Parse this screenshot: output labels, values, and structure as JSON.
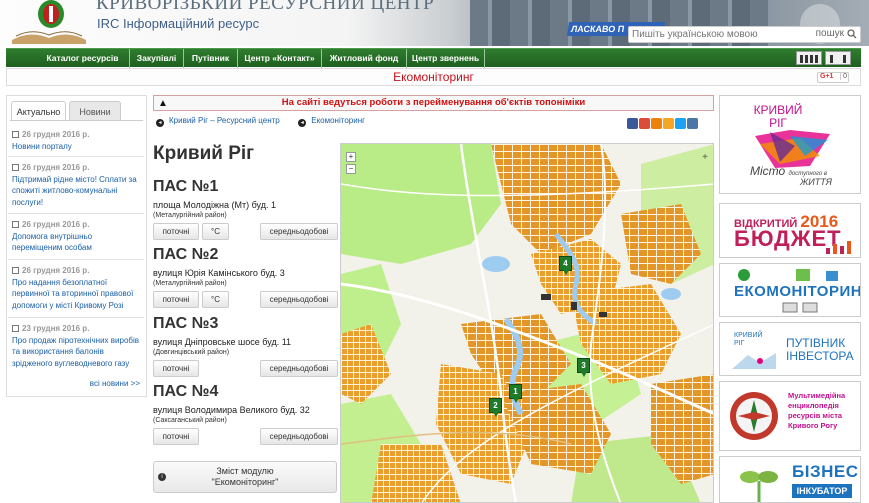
{
  "header": {
    "title_main": "КРИВОРІЗЬКИЙ РЕСУРСНИЙ ЦЕНТР",
    "title_sub": "IRC Інформаційний ресурс",
    "building_sign": "ЛАСКАВО П",
    "search_placeholder": "Пишіть українською мовою",
    "search_button": "пошук"
  },
  "nav": {
    "items": [
      "Каталог ресурсів",
      "Закупівлі",
      "Путівник",
      "Центр «Контакт»",
      "Житловий фонд",
      "Центр звернень"
    ]
  },
  "subtitle": "Екомоніторинг",
  "gplus": {
    "label": "G+1",
    "count": "0"
  },
  "left": {
    "tabs": [
      "Актуально",
      "Новини"
    ],
    "news": [
      {
        "date": "26 грудня 2016 р.",
        "title": "Новини порталу"
      },
      {
        "date": "26 грудня 2016 р.",
        "title": "Підтримай рідне місто! Сплати за спожиті житлово-комунальні послуги!"
      },
      {
        "date": "26 грудня 2016 р.",
        "title": "Допомога внутрішньо переміщеним особам"
      },
      {
        "date": "26 грудня 2016 р.",
        "title": "Про надання безоплатної первинної та вторинної правової допомоги у місті Кривому Розі"
      },
      {
        "date": "23 грудня 2016 р.",
        "title": "Про продаж піротехнічних виробів та використання балонів зрідженого вуглеводневого газу"
      }
    ],
    "all_news": "всі новини >>"
  },
  "notice": "На сайті ведуться роботи з перейменування об'єктів топоніміки",
  "breadcrumbs": [
    "Кривий Ріг – Ресурсний центр",
    "Екомоніторинг"
  ],
  "city_title": "Кривий Ріг",
  "stations": [
    {
      "name": "ПАС №1",
      "address": "площа Молодіжна (Мт) буд. 1",
      "district": "(Металургійний район)"
    },
    {
      "name": "ПАС №2",
      "address": "вулиця Юрія Камінського буд. 3",
      "district": "(Металургійний район)"
    },
    {
      "name": "ПАС №3",
      "address": "вулиця Дніпровське шосе буд. 11",
      "district": "(Довгинцівський район)"
    },
    {
      "name": "ПАС №4",
      "address": "вулиця Володимира Великого буд. 32",
      "district": "(Саксаганський район)"
    }
  ],
  "buttons": {
    "current": "поточні",
    "celsius": "°C",
    "daily": "середньодобові"
  },
  "module_box": {
    "line1": "Зміст модулю",
    "line2": "\"Екомоніторинг\""
  },
  "map": {
    "zoom_in": "+",
    "zoom_out": "−",
    "markers": [
      "1",
      "2",
      "3",
      "4"
    ]
  },
  "right": {
    "city_logo": {
      "l1": "КРИВИЙ",
      "l2": "РІГ",
      "l3": "Місто",
      "l4": "доступного в",
      "l5": "ЖИТТЯ"
    },
    "budget": {
      "l1": "ВІДКРИТИЙ",
      "year": "2016",
      "l2": "БЮДЖЕТ"
    },
    "ecomon": "ЕКОМОНІТОРИНГ",
    "investor": {
      "l1": "КРИВИЙ",
      "l2": "РІГ",
      "l3": "ПУТІВНИК",
      "l4": "ІНВЕСТОРА"
    },
    "encyclopedia": "Мультимедійна енциклопедія ресурсів міста Кривого Рогу",
    "business": {
      "l1": "БІЗНЕС",
      "l2": "ІНКУБАТОР"
    }
  },
  "colors": {
    "nav_green": "#1f5f1f",
    "accent_red": "#c3121b",
    "link": "#1a5fa8",
    "map_orange": "#e89a2a"
  }
}
